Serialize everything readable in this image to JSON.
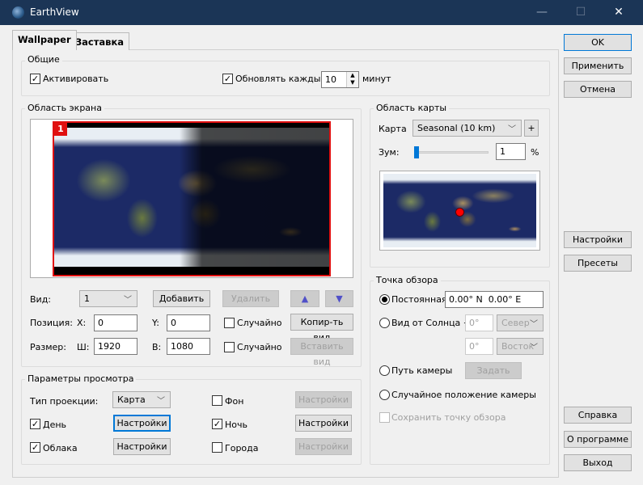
{
  "window": {
    "title": "EarthView",
    "minimize": "—",
    "maximize": "☐",
    "close": "✕"
  },
  "tabs": [
    {
      "label": "Wallpaper",
      "active": true
    },
    {
      "label": "Заставка",
      "active": false
    }
  ],
  "general": {
    "title": "Общие",
    "activate_label": "Активировать",
    "activate_checked": true,
    "update_label": "Обновлять каждые",
    "update_checked": true,
    "update_value": "10",
    "update_unit": "минут"
  },
  "screen_area": {
    "title": "Область экрана",
    "monitor_number": "1",
    "view_label": "Вид:",
    "view_value": "1",
    "add": "Добавить",
    "delete": "Удалить",
    "up": "▲",
    "down": "▼",
    "position_label": "Позиция:",
    "x_label": "X:",
    "x_value": "0",
    "y_label": "Y:",
    "y_value": "0",
    "random1": "Случайно",
    "copy_view": "Копир-ть вид",
    "size_label": "Размер:",
    "w_label": "Ш:",
    "w_value": "1920",
    "h_label": "В:",
    "h_value": "1080",
    "random2": "Случайно",
    "paste_view": "Вставить вид"
  },
  "view_params": {
    "title": "Параметры просмотра",
    "projection_label": "Тип проекции:",
    "projection_value": "Карта",
    "settings": "Настройки",
    "background": {
      "label": "Фон",
      "checked": false
    },
    "day": {
      "label": "День",
      "checked": true
    },
    "night": {
      "label": "Ночь",
      "checked": true
    },
    "clouds": {
      "label": "Облака",
      "checked": true
    },
    "cities": {
      "label": "Города",
      "checked": false
    }
  },
  "map_area": {
    "title": "Область карты",
    "map_label": "Карта",
    "map_value": "Seasonal (10 km)",
    "plus": "+",
    "zoom_label": "Зум:",
    "zoom_value": "1",
    "zoom_unit": "%",
    "zoom_fraction": 0.01
  },
  "viewpoint": {
    "title": "Точка обзора",
    "fixed_label": "Постоянная",
    "fixed_value": "0.00° N  0.00° E",
    "sun_label": "Вид от Солнца +",
    "sun_lat": "0°",
    "sun_lat_dir": "Север",
    "sun_lon": "0°",
    "sun_lon_dir": "Восток",
    "camera_path": "Путь камеры",
    "set": "Задать",
    "random_camera": "Случайное положение камеры",
    "save_viewpoint": "Сохранить точку обзора",
    "selected": "fixed"
  },
  "side_buttons": {
    "ok": "OK",
    "apply": "Применить",
    "cancel": "Отмена",
    "settings": "Настройки",
    "presets": "Пресеты",
    "help": "Справка",
    "about": "О программе",
    "exit": "Выход"
  },
  "colors": {
    "titlebar": "#1b3556",
    "accent": "#0078d7",
    "monitor_border": "#e01010"
  }
}
